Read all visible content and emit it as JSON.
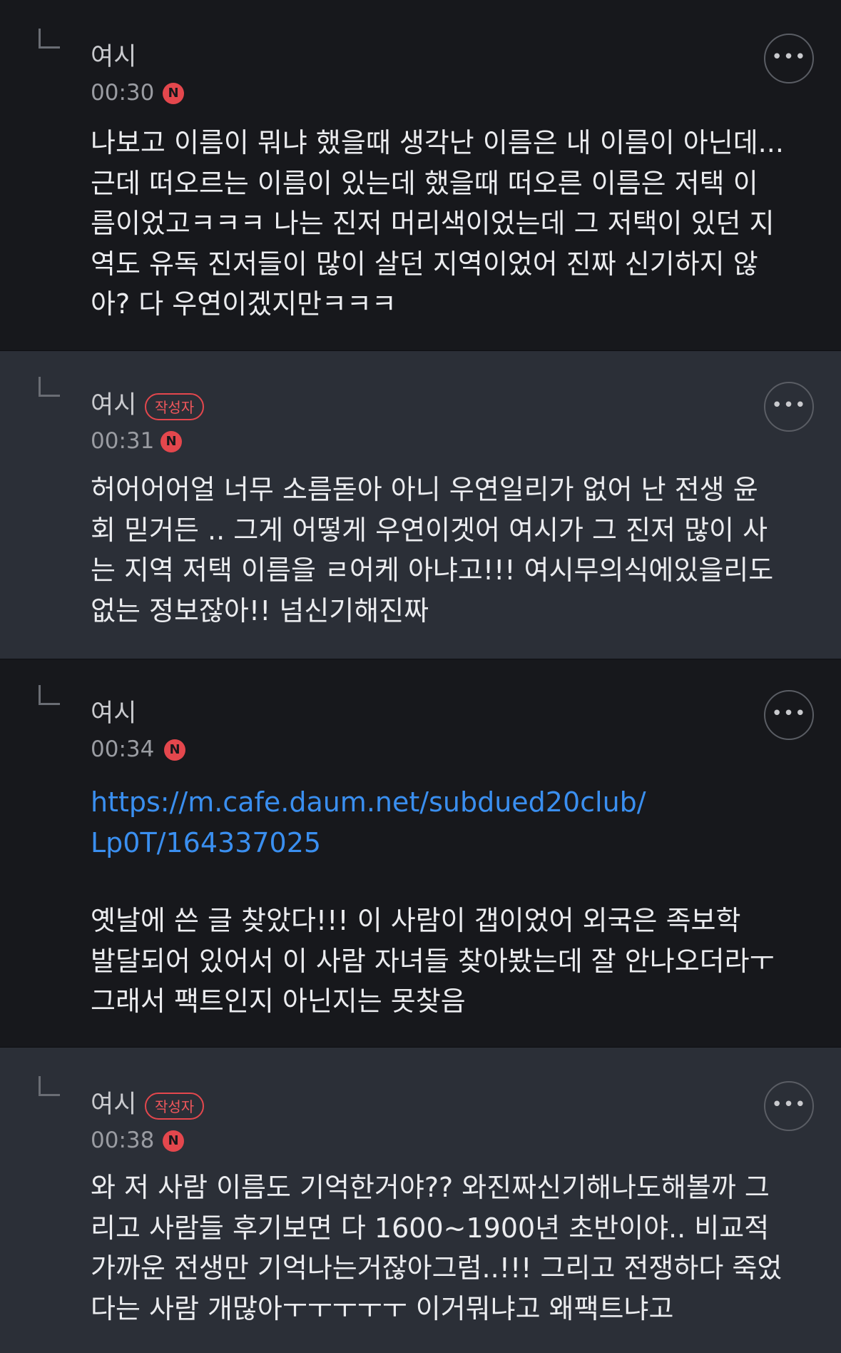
{
  "comments": [
    {
      "author": "여시",
      "badge": "",
      "time": "00:30",
      "new_label": "N",
      "more_label": "•••",
      "link": "",
      "text": "나보고 이름이 뭐냐 했을때 생각난 이름은 내 이름이 아닌데...\n근데 떠오르는 이름이 있는데 했을때 떠오른 이름은 저택 이\n름이었고ㅋㅋㅋ 나는 진저 머리색이었는데 그 저택이 있던 지\n역도 유독 진저들이 많이 살던 지역이었어 진짜 신기하지 않\n아? 다 우연이겠지만ㅋㅋㅋ"
    },
    {
      "author": "여시",
      "badge": "작성자",
      "time": "00:31",
      "new_label": "N",
      "more_label": "•••",
      "link": "",
      "text": "허어어어얼 너무 소름돋아 아니 우연일리가 없어 난 전생 윤\n회 믿거든 .. 그게 어떻게 우연이겟어 여시가 그 진저 많이 사\n는 지역 저택 이름을 ㄹ어케 아냐고!!! 여시무의식에있을리도\n없는 정보잖아!! 넘신기해진짜"
    },
    {
      "author": "여시",
      "badge": "",
      "time": "00:34",
      "new_label": "N",
      "more_label": "•••",
      "link": "https://m.cafe.daum.net/subdued20club/\nLp0T/164337025",
      "text": "옛날에 쓴 글 찾았다!!! 이 사람이 갭이었어 외국은 족보학\n발달되어 있어서 이 사람 자녀들 찾아봤는데 잘 안나오더라ㅜ\n그래서 팩트인지 아닌지는 못찾음"
    },
    {
      "author": "여시",
      "badge": "작성자",
      "time": "00:38",
      "new_label": "N",
      "more_label": "•••",
      "link": "",
      "text": "와 저 사람 이름도 기억한거야?? 와진짜신기해나도해볼까 그\n리고 사람들 후기보면 다 1600~1900년 초반이야.. 비교적\n가까운 전생만 기억나는거잖아그럼..!!! 그리고 전쟁하다 죽었\n다는 사람 개많아ㅜㅜㅜㅜㅜ 이거뭐냐고 왜팩트냐고"
    }
  ]
}
